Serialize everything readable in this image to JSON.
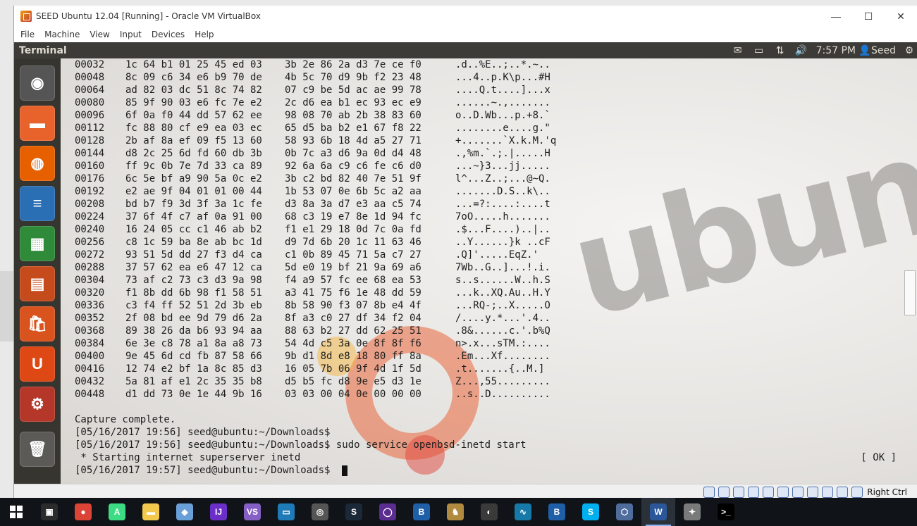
{
  "vbox": {
    "title": "SEED Ubuntu 12.04 [Running] - Oracle VM VirtualBox",
    "minimize_label": "—",
    "maximize_label": "☐",
    "close_label": "✕",
    "menu": [
      "File",
      "Machine",
      "View",
      "Input",
      "Devices",
      "Help"
    ],
    "host_key": "Right Ctrl"
  },
  "topbar": {
    "app_title": "Terminal",
    "clock": "7:57 PM",
    "user": "Seed",
    "icons": [
      "mail-icon",
      "battery-icon",
      "network-icon",
      "volume-icon",
      "user-icon",
      "gear-icon"
    ]
  },
  "launcher": {
    "items": [
      {
        "name": "ubuntu-dash-icon",
        "glyph": "◉",
        "color": "#555555"
      },
      {
        "name": "home-folder-icon",
        "glyph": "▬",
        "color": "#e8632b"
      },
      {
        "name": "firefox-icon",
        "glyph": "◍",
        "color": "#e66000"
      },
      {
        "name": "libreoffice-writer-icon",
        "glyph": "≡",
        "color": "#2a6eb3"
      },
      {
        "name": "libreoffice-calc-icon",
        "glyph": "▦",
        "color": "#2f8a3a"
      },
      {
        "name": "libreoffice-impress-icon",
        "glyph": "▤",
        "color": "#c64b1c"
      },
      {
        "name": "software-center-icon",
        "glyph": "🛍",
        "color": "#d9531e"
      },
      {
        "name": "ubuntu-one-icon",
        "glyph": "U",
        "color": "#dd4814"
      },
      {
        "name": "system-settings-icon",
        "glyph": "⚙",
        "color": "#b5372a"
      },
      {
        "name": "trash-icon",
        "glyph": "🗑",
        "color": "#5b5a56"
      }
    ]
  },
  "terminal": {
    "hexdump": [
      {
        "offset": "00032",
        "b1": "1c 64 b1 01 25 45 ed 03",
        "b2": "3b 2e 86 2a d3 7e ce f0",
        "ascii": ".d..%E..;..*.~.."
      },
      {
        "offset": "00048",
        "b1": "8c 09 c6 34 e6 b9 70 de",
        "b2": "4b 5c 70 d9 9b f2 23 48",
        "ascii": "...4..p.K\\p...#H"
      },
      {
        "offset": "00064",
        "b1": "ad 82 03 dc 51 8c 74 82",
        "b2": "07 c9 be 5d ac ae 99 78",
        "ascii": "....Q.t....]...x"
      },
      {
        "offset": "00080",
        "b1": "85 9f 90 03 e6 fc 7e e2",
        "b2": "2c d6 ea b1 ec 93 ec e9",
        "ascii": "......~.,......."
      },
      {
        "offset": "00096",
        "b1": "6f 0a f0 44 dd 57 62 ee",
        "b2": "98 08 70 ab 2b 38 83 60",
        "ascii": "o..D.Wb...p.+8.`"
      },
      {
        "offset": "00112",
        "b1": "fc 88 80 cf e9 ea 03 ec",
        "b2": "65 d5 ba b2 e1 67 f8 22",
        "ascii": "........e....g.\""
      },
      {
        "offset": "00128",
        "b1": "2b af 8a ef 09 f5 13 60",
        "b2": "58 93 6b 18 4d a5 27 71",
        "ascii": "+.......`X.k.M.'q"
      },
      {
        "offset": "00144",
        "b1": "d8 2c 25 6d fd 60 db 3b",
        "b2": "0b 7c a3 d6 9a 0d d4 48",
        "ascii": ".,%m.`.;.|.....H"
      },
      {
        "offset": "00160",
        "b1": "ff 9c 0b 7e 7d 33 ca 89",
        "b2": "92 6a 6a c9 c6 fe c6 d0",
        "ascii": "...~}3...jj....."
      },
      {
        "offset": "00176",
        "b1": "6c 5e bf a9 90 5a 0c e2",
        "b2": "3b c2 bd 82 40 7e 51 9f",
        "ascii": "l^...Z..;...@~Q."
      },
      {
        "offset": "00192",
        "b1": "e2 ae 9f 04 01 01 00 44",
        "b2": "1b 53 07 0e 6b 5c a2 aa",
        "ascii": ".......D.S..k\\.."
      },
      {
        "offset": "00208",
        "b1": "bd b7 f9 3d 3f 3a 1c fe",
        "b2": "d3 8a 3a d7 e3 aa c5 74",
        "ascii": "...=?:....:....t"
      },
      {
        "offset": "00224",
        "b1": "37 6f 4f c7 af 0a 91 00",
        "b2": "68 c3 19 e7 8e 1d 94 fc",
        "ascii": "7oO.....h......."
      },
      {
        "offset": "00240",
        "b1": "16 24 05 cc c1 46 ab b2",
        "b2": "f1 e1 29 18 0d 7c 0a fd",
        "ascii": ".$...F....)..|.."
      },
      {
        "offset": "00256",
        "b1": "c8 1c 59 ba 8e ab bc 1d",
        "b2": "d9 7d 6b 20 1c 11 63 46",
        "ascii": "..Y......}k ..cF"
      },
      {
        "offset": "00272",
        "b1": "93 51 5d dd 27 f3 d4 ca",
        "b2": "c1 0b 89 45 71 5a c7 27",
        "ascii": ".Q]'.....EqZ.'"
      },
      {
        "offset": "00288",
        "b1": "37 57 62 ea e6 47 12 ca",
        "b2": "5d e0 19 bf 21 9a 69 a6",
        "ascii": "7Wb..G..]...!.i."
      },
      {
        "offset": "00304",
        "b1": "73 af c2 73 c3 d3 9a 98",
        "b2": "f4 a9 57 fc ee 68 ea 53",
        "ascii": "s..s......W..h.S"
      },
      {
        "offset": "00320",
        "b1": "f1 8b dd 6b 98 f1 58 51",
        "b2": "a3 41 75 f6 1e 48 dd 59",
        "ascii": "...k..XQ.Au..H.Y"
      },
      {
        "offset": "00336",
        "b1": "c3 f4 ff 52 51 2d 3b eb",
        "b2": "8b 58 90 f3 07 8b e4 4f",
        "ascii": "...RQ-;..X.....O"
      },
      {
        "offset": "00352",
        "b1": "2f 08 bd ee 9d 79 d6 2a",
        "b2": "8f a3 c0 27 df 34 f2 04",
        "ascii": "/....y.*...'.4.."
      },
      {
        "offset": "00368",
        "b1": "89 38 26 da b6 93 94 aa",
        "b2": "88 63 b2 27 dd 62 25 51",
        "ascii": ".8&......c.'.b%Q"
      },
      {
        "offset": "00384",
        "b1": "6e 3e c8 78 a1 8a a8 73",
        "b2": "54 4d c5 3a 0e 8f 8f f6",
        "ascii": "n>.x...sTM.:...."
      },
      {
        "offset": "00400",
        "b1": "9e 45 6d cd fb 87 58 66",
        "b2": "9b d1 8d e8 18 80 ff 8a",
        "ascii": ".Em...Xf........"
      },
      {
        "offset": "00416",
        "b1": "12 74 e2 bf 1a 8c 85 d3",
        "b2": "16 05 7b 06 9f 4d 1f 5d",
        "ascii": ".t.......{..M.]"
      },
      {
        "offset": "00432",
        "b1": "5a 81 af e1 2c 35 35 b8",
        "b2": "d5 b5 fc d8 9e e5 d3 1e",
        "ascii": "Z...,55........."
      },
      {
        "offset": "00448",
        "b1": "d1 dd 73 0e 1e 44 9b 16",
        "b2": "03 03 00 04 0e 00 00 00",
        "ascii": "..s..D.........."
      }
    ],
    "capture_line": "Capture complete.",
    "prompt1": "[05/16/2017 19:56] seed@ubuntu:~/Downloads$",
    "prompt2": "[05/16/2017 19:56] seed@ubuntu:~/Downloads$ sudo service openbsd-inetd start",
    "starting": " * Starting internet superserver inetd",
    "ok": "[ OK ]",
    "prompt3": "[05/16/2017 19:57] seed@ubuntu:~/Downloads$ "
  },
  "taskbar": {
    "items": [
      {
        "name": "edge-store-icon",
        "glyph": "▣",
        "color": "#2b2b2b"
      },
      {
        "name": "chrome-icon",
        "glyph": "●",
        "color": "#db4437"
      },
      {
        "name": "android-studio-icon",
        "glyph": "A",
        "color": "#3ddc84"
      },
      {
        "name": "file-explorer-icon",
        "glyph": "▬",
        "color": "#f2c94c"
      },
      {
        "name": "virtualbox-cube-icon",
        "glyph": "◆",
        "color": "#6aa0d8"
      },
      {
        "name": "jetbrains-icon",
        "glyph": "IJ",
        "color": "#6b2fc8"
      },
      {
        "name": "visual-studio-icon",
        "glyph": "VS",
        "color": "#865fc5"
      },
      {
        "name": "lenovo-screen-icon",
        "glyph": "▭",
        "color": "#1f7ab8"
      },
      {
        "name": "camera-app-icon",
        "glyph": "◎",
        "color": "#555555"
      },
      {
        "name": "steam-icon",
        "glyph": "S",
        "color": "#1b2838"
      },
      {
        "name": "circle-app-icon",
        "glyph": "◯",
        "color": "#5c2d91"
      },
      {
        "name": "blizzard-icon",
        "glyph": "B",
        "color": "#1f5fa8"
      },
      {
        "name": "game-figure-icon",
        "glyph": "♞",
        "color": "#b08a3e"
      },
      {
        "name": "overwatch-icon",
        "glyph": "◐",
        "color": "#3a3a3a"
      },
      {
        "name": "wireshark-icon",
        "glyph": "∿",
        "color": "#1679a7"
      },
      {
        "name": "blizzard-app-icon",
        "glyph": "B",
        "color": "#1f5fa8"
      },
      {
        "name": "skype-icon",
        "glyph": "S",
        "color": "#00aff0"
      },
      {
        "name": "virtualbox-icon",
        "glyph": "⬡",
        "color": "#4f6d9c"
      },
      {
        "name": "word-icon",
        "glyph": "W",
        "color": "#2b579a"
      },
      {
        "name": "parrot-icon",
        "glyph": "✦",
        "color": "#7a7a7a"
      },
      {
        "name": "cmd-icon",
        "glyph": ">_",
        "color": "#000000"
      }
    ]
  }
}
